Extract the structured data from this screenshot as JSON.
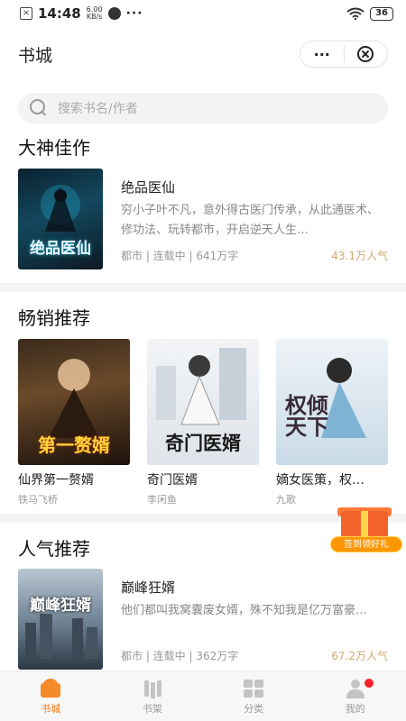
{
  "status_bar": {
    "time": "14:48",
    "speed_value": "6.00",
    "speed_unit": "KB/s",
    "more": "···",
    "battery": "36"
  },
  "header": {
    "title": "书城",
    "more_label": "···"
  },
  "search": {
    "placeholder": "搜索书名/作者"
  },
  "sections": {
    "featured_title": "大神佳作",
    "bestseller_title": "畅销推荐",
    "popular_title": "人气推荐"
  },
  "featured_book": {
    "title": "绝品医仙",
    "description": "穷小子叶不凡，意外得古医门传承，从此通医术、修功法、玩转都市，开启逆天人生…",
    "meta": "都市 | 连载中 | 641万字",
    "popularity": "43.1万人气",
    "cover_text": "绝品医仙"
  },
  "bestsellers": [
    {
      "title": "仙界第一赘婿",
      "author": "铁马飞桥",
      "cover_text": "第一赘婿"
    },
    {
      "title": "奇门医婿",
      "author": "李闲鱼",
      "cover_text": "奇门医婿"
    },
    {
      "title": "嫡女医策，权…",
      "author": "九歌",
      "cover_text": "权倾天下"
    }
  ],
  "popular_book": {
    "title": "巅峰狂婿",
    "description": "他们都叫我窝囊废女婿，殊不知我是亿万富豪…",
    "meta": "都市 | 连载中 | 362万字",
    "popularity": "67.2万人气",
    "cover_text": "巅峰狂婿"
  },
  "gift": {
    "label": "签到领好礼"
  },
  "tabs": [
    {
      "label": "书城",
      "icon": "bookstore-icon",
      "active": true
    },
    {
      "label": "书架",
      "icon": "bookshelf-icon",
      "active": false
    },
    {
      "label": "分类",
      "icon": "category-icon",
      "active": false
    },
    {
      "label": "我的",
      "icon": "profile-icon",
      "active": false
    }
  ],
  "colors": {
    "accent": "#f27b1c",
    "popularity": "#d3a76d",
    "badge": "#f5222d"
  }
}
